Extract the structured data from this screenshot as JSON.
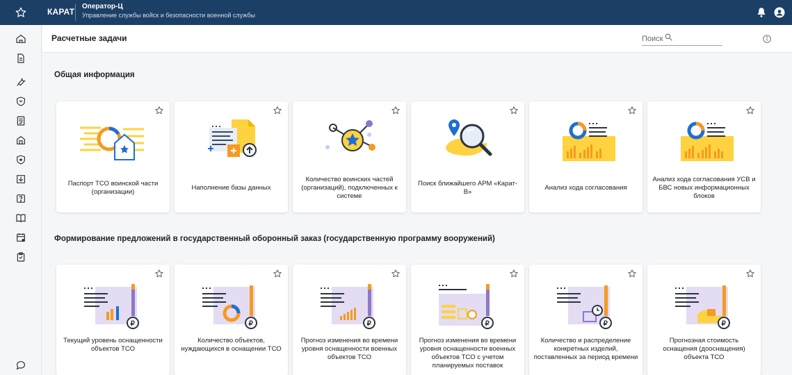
{
  "topbar": {
    "brand": "КАРАТ",
    "operator_title": "Оператор-Ц",
    "operator_subtitle": "Управление службы войск и безопасности военной службы"
  },
  "header": {
    "title": "Расчетные задачи",
    "search_placeholder": "Поиск"
  },
  "sections": [
    {
      "title": "Общая информация",
      "cards": [
        {
          "label": "Паспорт ТСО воинской части (организации)",
          "illustration": "building-chart-icon"
        },
        {
          "label": "Наполнение базы данных",
          "illustration": "documents-upload-icon"
        },
        {
          "label": "Количество воинских частей (организаций), подключенных к системе",
          "illustration": "network-star-icon"
        },
        {
          "label": "Поиск ближайшего АРМ «Карат-В»",
          "illustration": "map-search-icon"
        },
        {
          "label": "Анализ хода согласования",
          "illustration": "donut-bars-icon"
        },
        {
          "label": "Анализ хода согласования УСВ и БВС новых информационных блоков",
          "illustration": "donut-bars-icon"
        }
      ]
    },
    {
      "title": "Формирование предложений в государственный оборонный заказ (государственную программу вооружений)",
      "cards": [
        {
          "label": "Текущий уровень оснащенности объектов ТСО",
          "illustration": "report-bars-icon"
        },
        {
          "label": "Количество объектов, нуждающихся в оснащении ТСО",
          "illustration": "report-donut-icon"
        },
        {
          "label": "Прогноз изменения во времени уровня оснащенности военных объектов ТСО",
          "illustration": "report-trend-icon"
        },
        {
          "label": "Прогноз изменения во времени уровня оснащенности военных объектов ТСО с учетом планируемых поставок",
          "illustration": "report-clock-icon"
        },
        {
          "label": "Количество и распределение конкретных изделий, поставленных за период времени",
          "illustration": "report-box-clock-icon"
        },
        {
          "label": "Прогнозная стоимость оснащения (дооснащения) объекта ТСО",
          "illustration": "report-money-icon"
        }
      ]
    }
  ],
  "sidebar_icons": [
    "home-icon",
    "document-icon",
    "wrench-icon",
    "shield-icon",
    "checklist-icon",
    "archive-icon",
    "star-shield-icon",
    "download-icon",
    "help-icon",
    "book-icon",
    "calendar-icon",
    "clipboard-icon",
    "chat-icon"
  ],
  "colors": {
    "topbar": "#1c3f66",
    "accent_blue": "#1f6fd1",
    "illus_yellow": "#ffd23f",
    "illus_orange": "#f59a23",
    "illus_lavender": "#e3dcf3",
    "illus_purple": "#8f78c7"
  }
}
